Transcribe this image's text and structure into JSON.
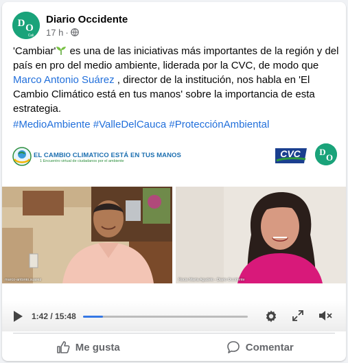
{
  "post": {
    "page_name": "Diario Occidente",
    "time": "17 h",
    "dot": "·",
    "privacy_icon": "globe-icon",
    "avatar_letters": "DO",
    "avatar_sub": "Cali",
    "text": {
      "part1": "'Cambiar'",
      "part2": " es una de las iniciativas más importantes de la región y del país en pro del medio ambiente, liderada por la CVC, de modo que ",
      "mention": "Marco Antonio Suárez",
      "part3": "  , director de la institución, nos habla en 'El Cambio Climático está en tus manos' sobre la importancia de esta estrategia."
    },
    "hashtags": [
      "#MedioAmbiente",
      "#ValleDelCauca",
      "#ProtecciónAmbiental"
    ]
  },
  "video": {
    "banner_title": "EL CAMBIO CLIMATICO ESTÁ EN TUS MANOS",
    "banner_subtitle": "1 Encuentro virtual de ciudadanos por el ambiente",
    "cvc_label": "CVC",
    "do_label": "DO",
    "left_name": "marco-antonio.suarez",
    "right_name": "Rocio María Agudelo - Diario Occidente",
    "current_time": "1:42",
    "separator": " / ",
    "duration": "15:48",
    "progress": 0.12
  },
  "actions": {
    "like": "Me gusta",
    "comment": "Comentar"
  },
  "colors": {
    "link": "#216fdb",
    "brand_green": "#1aa37a",
    "progress": "#3578e5"
  }
}
